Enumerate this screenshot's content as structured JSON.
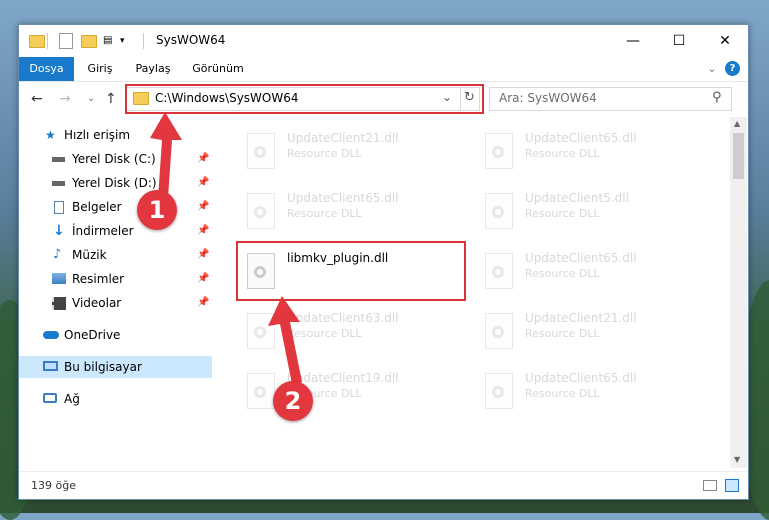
{
  "window": {
    "title": "SysWOW64",
    "controls": {
      "minimize": "—",
      "maximize": "☐",
      "close": "✕"
    }
  },
  "ribbon": {
    "tabs": [
      {
        "label": "Dosya",
        "active": true
      },
      {
        "label": "Giriş"
      },
      {
        "label": "Paylaş"
      },
      {
        "label": "Görünüm"
      }
    ],
    "collapse": "⌄",
    "help": "?"
  },
  "navigation": {
    "back": "←",
    "forward": "→",
    "recent": "⌄",
    "up": "↑",
    "address": "C:\\Windows\\SysWOW64",
    "address_dropdown": "⌄",
    "refresh": "↻",
    "search_placeholder": "Ara: SysWOW64",
    "search_icon": "⚲"
  },
  "sidebar": {
    "quick_access": "Hızlı erişim",
    "items": [
      {
        "label": "Yerel Disk (C:)",
        "icon": "drive-icon",
        "pinned": true
      },
      {
        "label": "Yerel Disk (D:)",
        "icon": "drive-icon",
        "pinned": true
      },
      {
        "label": "Belgeler",
        "icon": "documents-icon",
        "pinned": true
      },
      {
        "label": "İndirmeler",
        "icon": "downloads-icon",
        "pinned": true
      },
      {
        "label": "Müzik",
        "icon": "music-icon",
        "pinned": true
      },
      {
        "label": "Resimler",
        "icon": "pictures-icon",
        "pinned": true
      },
      {
        "label": "Videolar",
        "icon": "videos-icon",
        "pinned": true
      }
    ],
    "onedrive": "OneDrive",
    "this_pc": "Bu bilgisayar",
    "network": "Ağ",
    "pin_glyph": "📌"
  },
  "files": [
    {
      "name": "UpdateClient21.dll",
      "type": "Resource DLL",
      "faded": true
    },
    {
      "name": "UpdateClient65.dll",
      "type": "Resource DLL",
      "faded": true
    },
    {
      "name": "UpdateClient65.dll",
      "type": "Resource DLL",
      "faded": true
    },
    {
      "name": "UpdateClient5.dll",
      "type": "Resource DLL",
      "faded": true
    },
    {
      "name": "libmkv_plugin.dll",
      "type": "",
      "faded": false,
      "highlighted": true
    },
    {
      "name": "UpdateClient65.dll",
      "type": "Resource DLL",
      "faded": true
    },
    {
      "name": "UpdateClient63.dll",
      "type": "Resource DLL",
      "faded": true
    },
    {
      "name": "UpdateClient21.dll",
      "type": "Resource DLL",
      "faded": true
    },
    {
      "name": "UpdateClient19.dll",
      "type": "Resource DLL",
      "faded": true
    },
    {
      "name": "UpdateClient65.dll",
      "type": "Resource DLL",
      "faded": true
    }
  ],
  "status": {
    "count": "139 öğe"
  },
  "callouts": {
    "one": "1",
    "two": "2"
  },
  "colors": {
    "accent": "#1979ca",
    "callout": "#e2373e",
    "selected": "#cce8ff"
  }
}
